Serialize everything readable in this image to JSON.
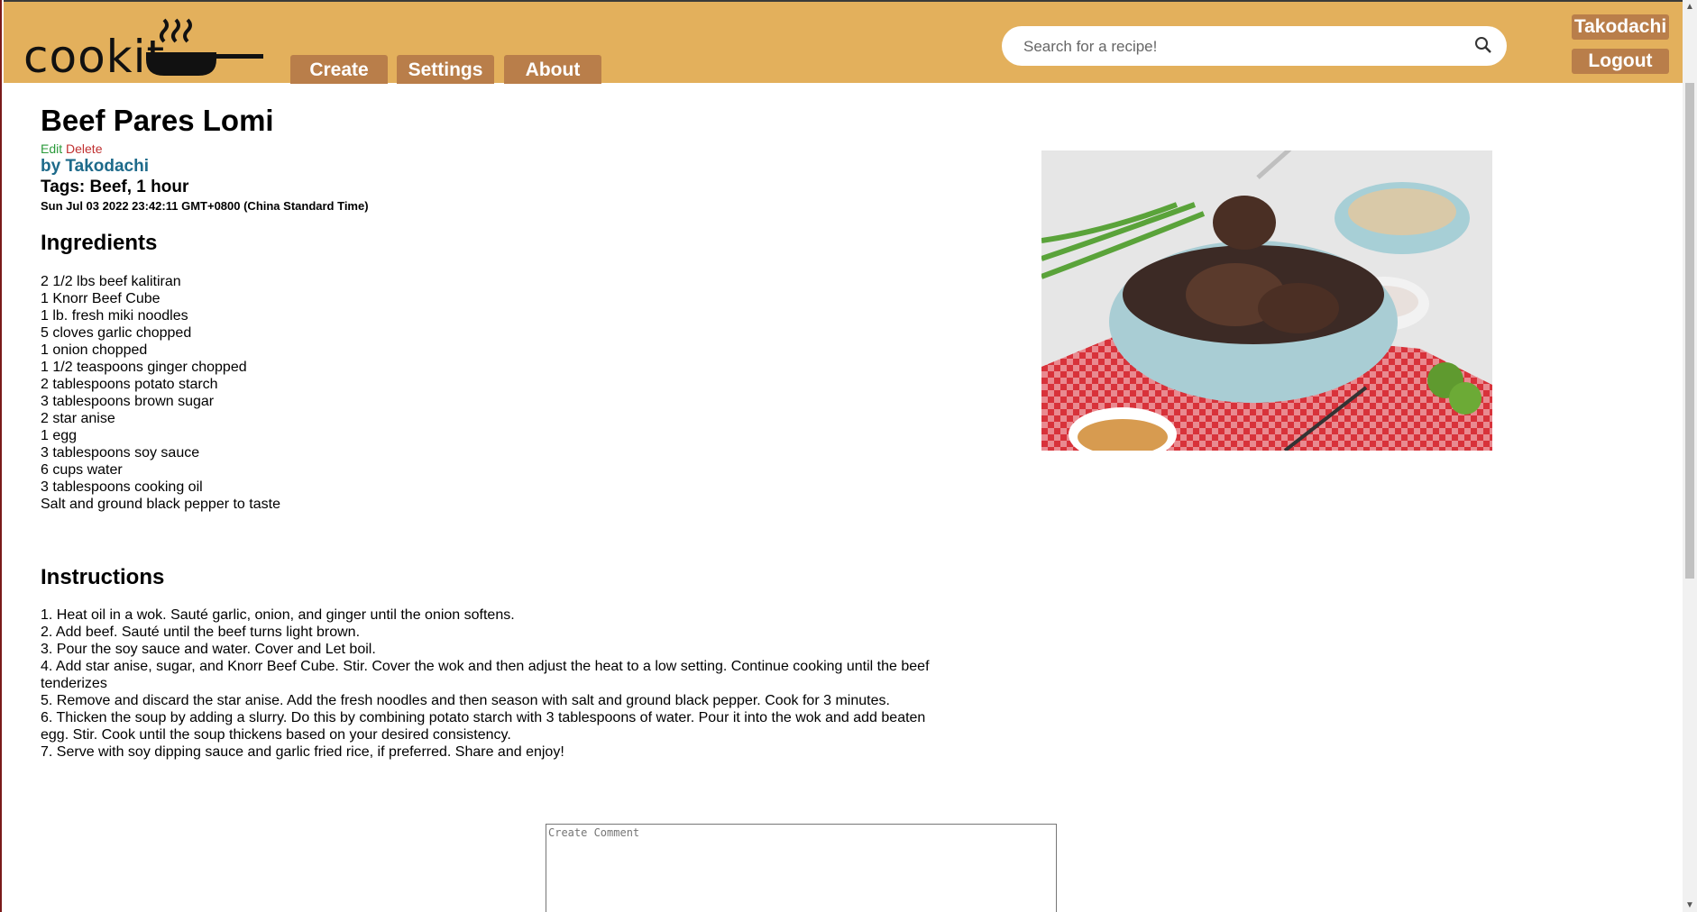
{
  "header": {
    "logo_text": "cookit",
    "nav": [
      {
        "label": "Create"
      },
      {
        "label": "Settings"
      },
      {
        "label": "About"
      }
    ],
    "search": {
      "placeholder": "Search for a recipe!"
    },
    "user": {
      "name": "Takodachi",
      "logout_label": "Logout"
    }
  },
  "recipe": {
    "title": "Beef Pares Lomi",
    "edit_label": "Edit",
    "delete_label": "Delete",
    "author": "by Takodachi",
    "tags": "Tags: Beef, 1 hour",
    "date": "Sun Jul 03 2022 23:42:11 GMT+0800 (China Standard Time)",
    "ingredients_heading": "Ingredients",
    "ingredients": [
      "2 1/2 lbs beef kalitiran",
      "1 Knorr Beef Cube",
      "1 lb. fresh miki noodles",
      "5 cloves garlic chopped",
      "1 onion chopped",
      "1 1/2 teaspoons ginger chopped",
      "2 tablespoons potato starch",
      "3 tablespoons brown sugar",
      "2 star anise",
      "1 egg",
      "3 tablespoons soy sauce",
      "6 cups water",
      "3 tablespoons cooking oil",
      "Salt and ground black pepper to taste"
    ],
    "instructions_heading": "Instructions",
    "instructions": [
      "1. Heat oil in a wok. Sauté garlic, onion, and ginger until the onion softens.",
      "2. Add beef. Sauté until the beef turns light brown.",
      "3. Pour the soy sauce and water. Cover and Let boil.",
      "4. Add star anise, sugar, and Knorr Beef Cube. Stir. Cover the wok and then adjust the heat to a low setting. Continue cooking until the beef tenderizes",
      "5. Remove and discard the star anise. Add the fresh noodles and then season with salt and ground black pepper. Cook for 3 minutes.",
      "6. Thicken the soup by adding a slurry. Do this by combining potato starch with 3 tablespoons of water. Pour it into the wok and add beaten egg. Stir. Cook until the soup thickens based on your desired consistency.",
      "7. Serve with soy dipping sauce and garlic fried rice, if preferred. Share and enjoy!"
    ],
    "comment_placeholder": "Create Comment"
  },
  "colors": {
    "header_bg": "#e3b05c",
    "button_bg": "#b97e4a",
    "author_link": "#1d6a8a",
    "edit_link": "#2a9a3a",
    "delete_link": "#c03030"
  },
  "icons": {
    "search": "search-icon",
    "logo": "frying-pan-steam-icon"
  }
}
